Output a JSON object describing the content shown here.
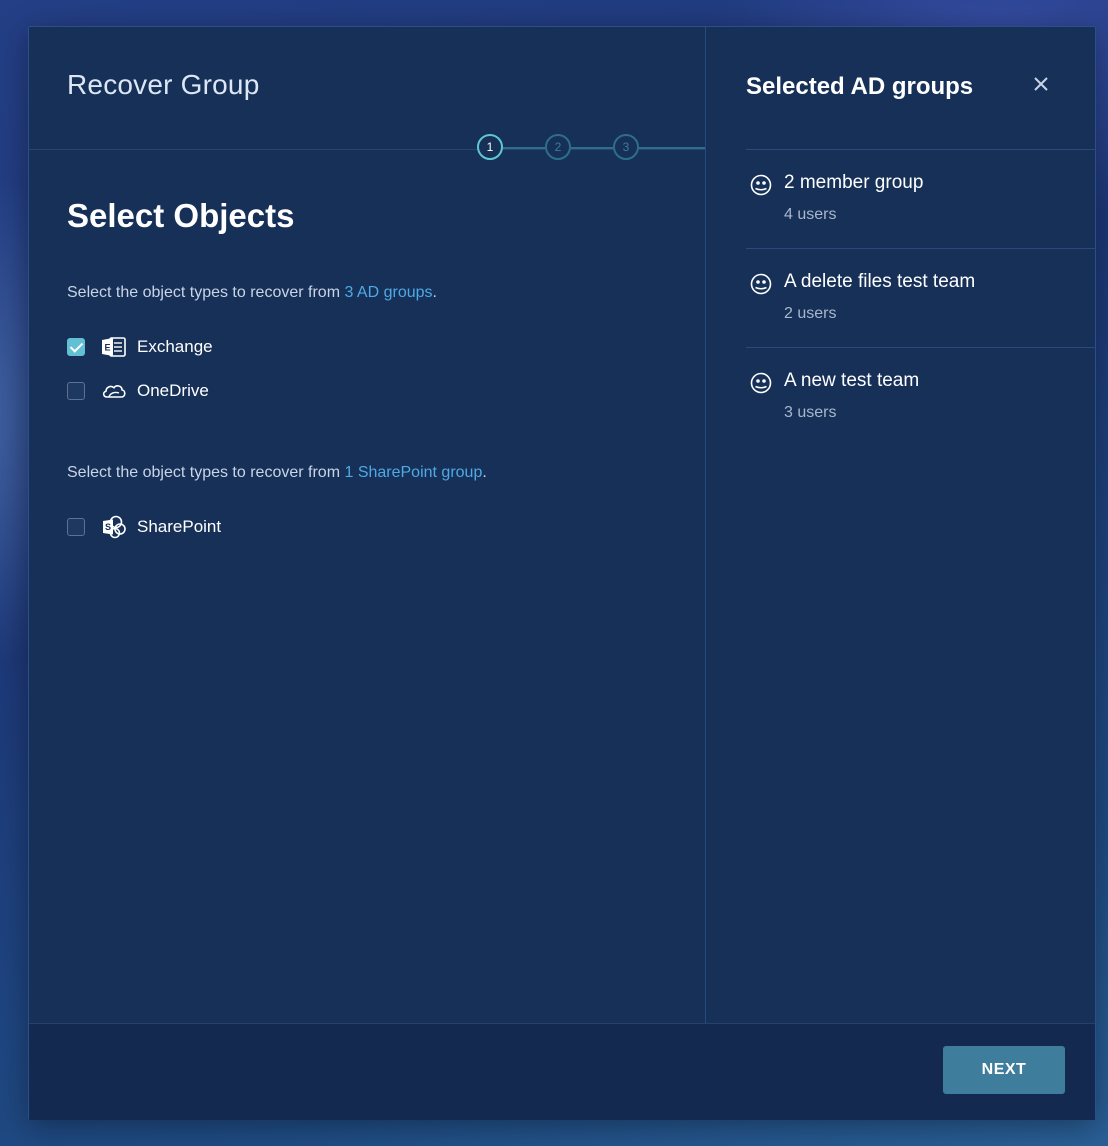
{
  "modal": {
    "title": "Recover Group"
  },
  "stepper": {
    "steps": [
      "1",
      "2",
      "3"
    ],
    "active_step": 1
  },
  "main": {
    "heading": "Select Objects",
    "ad_instruction": {
      "prefix": "Select the object types to recover from ",
      "link": "3 AD groups",
      "suffix": "."
    },
    "ad_options": [
      {
        "label": "Exchange",
        "checked": true,
        "icon": "exchange-icon"
      },
      {
        "label": "OneDrive",
        "checked": false,
        "icon": "onedrive-icon"
      }
    ],
    "sp_instruction": {
      "prefix": "Select the object types to recover from ",
      "link": "1 SharePoint group",
      "suffix": "."
    },
    "sp_options": [
      {
        "label": "SharePoint",
        "checked": false,
        "icon": "sharepoint-icon"
      }
    ]
  },
  "panel": {
    "title": "Selected AD groups",
    "close_icon": "close-icon",
    "groups": [
      {
        "name": "2 member group",
        "count": "4 users",
        "icon": "group-icon"
      },
      {
        "name": "A delete files test team",
        "count": "2 users",
        "icon": "group-icon"
      },
      {
        "name": "A new test team",
        "count": "3 users",
        "icon": "group-icon"
      }
    ]
  },
  "footer": {
    "next_label": "NEXT"
  },
  "colors": {
    "accent": "#62bfd4",
    "link": "#4fa9e6",
    "button": "#3e7d9b",
    "modal_bg": "#163058"
  }
}
